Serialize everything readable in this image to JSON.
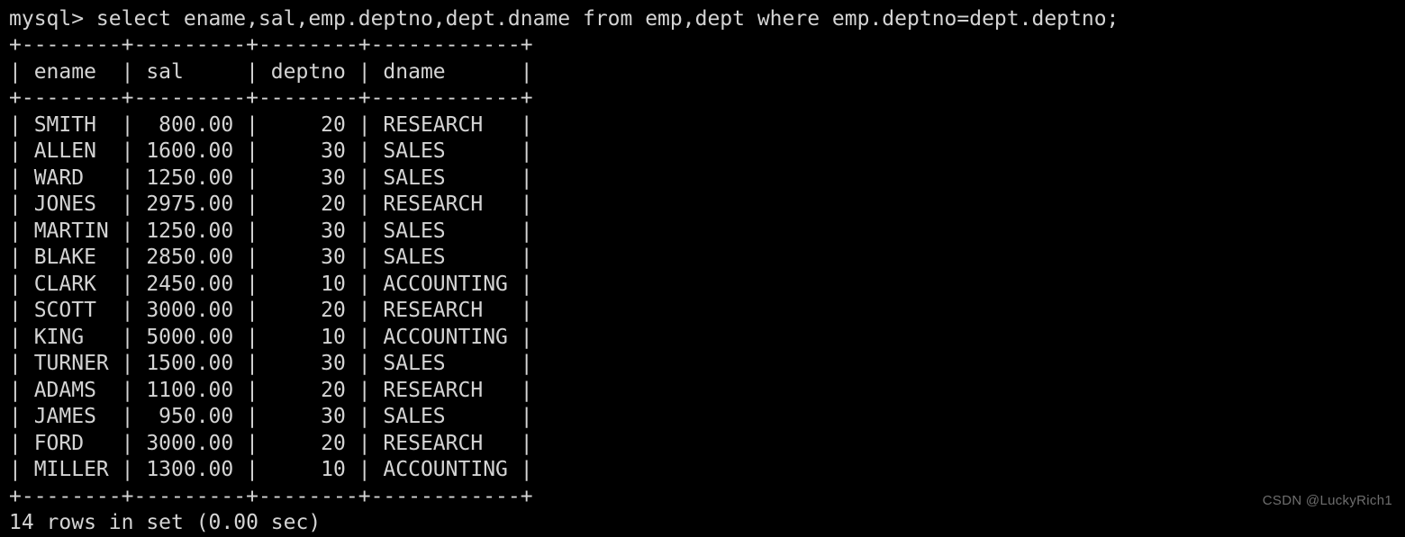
{
  "terminal": {
    "background_color": "#000000",
    "text_color": "#d4d4d4",
    "prompt_line": "mysql> select ename,sal,emp.deptno,dept.dname from emp,dept where emp.deptno=dept.deptno;",
    "clipped_top_line": "+--------+---------+--------+------------+",
    "separator": "+--------+---------+--------+------------+",
    "header_row": "| ename  | sal     | deptno | dname      |",
    "status": "14 rows in set (0.00 sec)",
    "columns": [
      {
        "name": "ename",
        "width": 8,
        "align": "left"
      },
      {
        "name": "sal",
        "width": 9,
        "align": "right"
      },
      {
        "name": "deptno",
        "width": 8,
        "align": "right"
      },
      {
        "name": "dname",
        "width": 12,
        "align": "left"
      }
    ],
    "rows": [
      {
        "ename": "SMITH",
        "sal": "800.00",
        "deptno": "20",
        "dname": "RESEARCH",
        "text": "| SMITH  |  800.00 |     20 | RESEARCH   |"
      },
      {
        "ename": "ALLEN",
        "sal": "1600.00",
        "deptno": "30",
        "dname": "SALES",
        "text": "| ALLEN  | 1600.00 |     30 | SALES      |"
      },
      {
        "ename": "WARD",
        "sal": "1250.00",
        "deptno": "30",
        "dname": "SALES",
        "text": "| WARD   | 1250.00 |     30 | SALES      |"
      },
      {
        "ename": "JONES",
        "sal": "2975.00",
        "deptno": "20",
        "dname": "RESEARCH",
        "text": "| JONES  | 2975.00 |     20 | RESEARCH   |"
      },
      {
        "ename": "MARTIN",
        "sal": "1250.00",
        "deptno": "30",
        "dname": "SALES",
        "text": "| MARTIN | 1250.00 |     30 | SALES      |"
      },
      {
        "ename": "BLAKE",
        "sal": "2850.00",
        "deptno": "30",
        "dname": "SALES",
        "text": "| BLAKE  | 2850.00 |     30 | SALES      |"
      },
      {
        "ename": "CLARK",
        "sal": "2450.00",
        "deptno": "10",
        "dname": "ACCOUNTING",
        "text": "| CLARK  | 2450.00 |     10 | ACCOUNTING |"
      },
      {
        "ename": "SCOTT",
        "sal": "3000.00",
        "deptno": "20",
        "dname": "RESEARCH",
        "text": "| SCOTT  | 3000.00 |     20 | RESEARCH   |"
      },
      {
        "ename": "KING",
        "sal": "5000.00",
        "deptno": "10",
        "dname": "ACCOUNTING",
        "text": "| KING   | 5000.00 |     10 | ACCOUNTING |"
      },
      {
        "ename": "TURNER",
        "sal": "1500.00",
        "deptno": "30",
        "dname": "SALES",
        "text": "| TURNER | 1500.00 |     30 | SALES      |"
      },
      {
        "ename": "ADAMS",
        "sal": "1100.00",
        "deptno": "20",
        "dname": "RESEARCH",
        "text": "| ADAMS  | 1100.00 |     20 | RESEARCH   |"
      },
      {
        "ename": "JAMES",
        "sal": "950.00",
        "deptno": "30",
        "dname": "SALES",
        "text": "| JAMES  |  950.00 |     30 | SALES      |"
      },
      {
        "ename": "FORD",
        "sal": "3000.00",
        "deptno": "20",
        "dname": "RESEARCH",
        "text": "| FORD   | 3000.00 |     20 | RESEARCH   |"
      },
      {
        "ename": "MILLER",
        "sal": "1300.00",
        "deptno": "10",
        "dname": "ACCOUNTING",
        "text": "| MILLER | 1300.00 |     10 | ACCOUNTING |"
      }
    ],
    "row_count": 14
  },
  "watermark": {
    "text": "CSDN @LuckyRich1",
    "color": "#6e6e6e"
  }
}
